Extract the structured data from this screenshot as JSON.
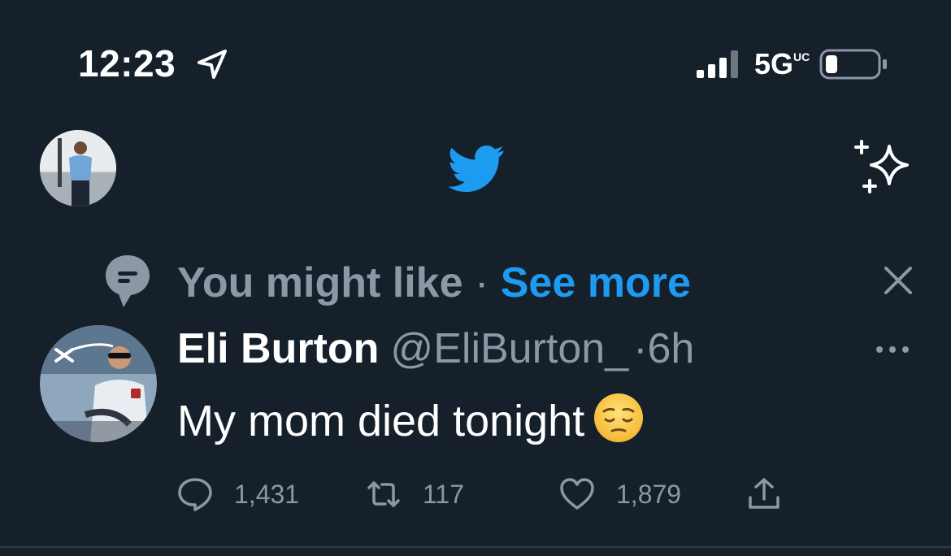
{
  "status_bar": {
    "time": "12:23",
    "network_label": "5G",
    "network_sub": "UC",
    "icons": [
      "location-arrow-icon",
      "signal-bars-icon",
      "battery-icon"
    ],
    "battery_level": 0.08
  },
  "header": {
    "logo": "twitter-bird-icon",
    "right_icon": "sparkle-icon",
    "colors": {
      "brand": "#1d9bf0",
      "background": "#15202b"
    }
  },
  "suggestion": {
    "label": "You might like",
    "separator": "·",
    "link": "See more",
    "icon": "speech-bubble-icon",
    "dismiss_icon": "close-icon"
  },
  "tweet": {
    "author_name": "Eli Burton",
    "handle": "@EliBurton_",
    "separator": "·",
    "time_ago": "6h",
    "text": "My mom died tonight",
    "emoji": "😔",
    "more_icon": "more-dots-icon",
    "actions": {
      "reply": "1,431",
      "retweet": "117",
      "like": "1,879"
    }
  },
  "colors": {
    "text_primary": "#ffffff",
    "text_secondary": "#8b98a5",
    "accent": "#1d9bf0"
  }
}
